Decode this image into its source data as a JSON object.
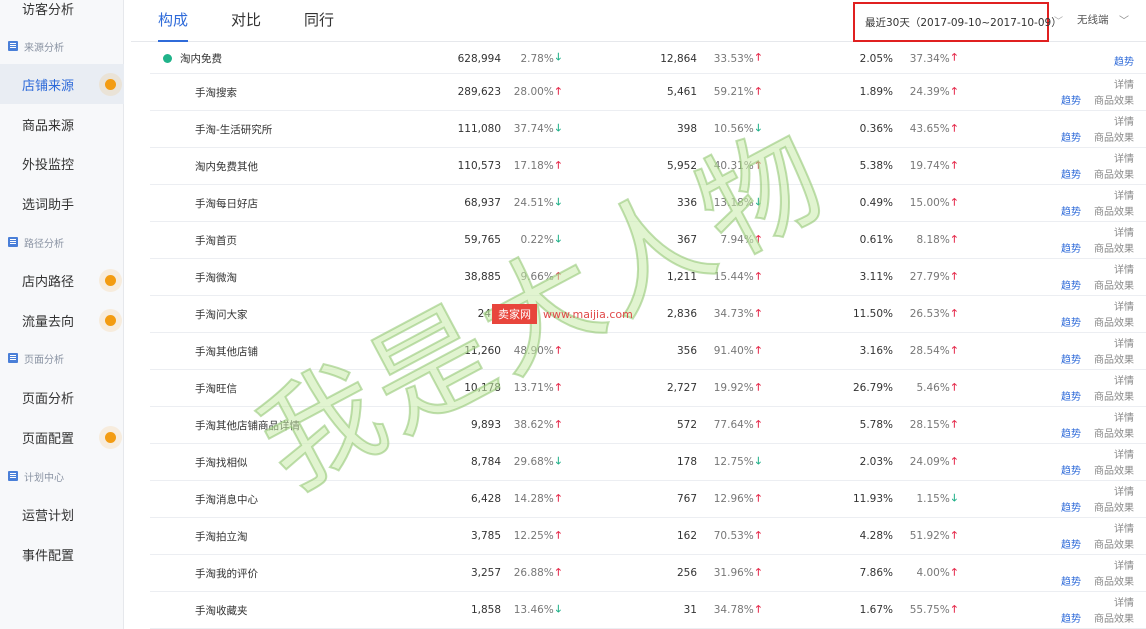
{
  "sidebar": {
    "top_item": "访客分析",
    "sections": [
      {
        "title": "来源分析",
        "items": [
          "店铺来源",
          "商品来源",
          "外投监控",
          "选词助手"
        ]
      },
      {
        "title": "路径分析",
        "items": [
          "店内路径",
          "流量去向"
        ]
      },
      {
        "title": "页面分析",
        "items": [
          "页面分析",
          "页面配置"
        ]
      },
      {
        "title": "计划中心",
        "items": [
          "运营计划",
          "事件配置"
        ]
      }
    ]
  },
  "tabs": [
    "构成",
    "对比",
    "同行"
  ],
  "date_range": "最近30天（2017-09-10~2017-10-09）",
  "device": "无线端",
  "links": {
    "detail": "详情",
    "trend": "趋势",
    "effect": "商品效果"
  },
  "watermark": {
    "text": "我是大人物",
    "site_logo": "卖家网",
    "site_url": "www.maijia.com"
  },
  "colors": {
    "accent": "#2f6bd9",
    "up": "#e5294a",
    "down": "#1fb088",
    "highlight_box": "#e02020"
  },
  "rows": [
    {
      "name": "淘内免费",
      "v1": "628,994",
      "p1": "2.78%",
      "d1": "down",
      "v2": "12,864",
      "p2": "33.53%",
      "d2": "up",
      "v3": "2.05%",
      "p3": "37.34%",
      "d3": "up"
    },
    {
      "name": "手淘搜索",
      "v1": "289,623",
      "p1": "28.00%",
      "d1": "up",
      "v2": "5,461",
      "p2": "59.21%",
      "d2": "up",
      "v3": "1.89%",
      "p3": "24.39%",
      "d3": "up"
    },
    {
      "name": "手淘-生活研究所",
      "v1": "111,080",
      "p1": "37.74%",
      "d1": "down",
      "v2": "398",
      "p2": "10.56%",
      "d2": "down",
      "v3": "0.36%",
      "p3": "43.65%",
      "d3": "up"
    },
    {
      "name": "淘内免费其他",
      "v1": "110,573",
      "p1": "17.18%",
      "d1": "up",
      "v2": "5,952",
      "p2": "40.31%",
      "d2": "up",
      "v3": "5.38%",
      "p3": "19.74%",
      "d3": "up"
    },
    {
      "name": "手淘每日好店",
      "v1": "68,937",
      "p1": "24.51%",
      "d1": "down",
      "v2": "336",
      "p2": "13.18%",
      "d2": "down",
      "v3": "0.49%",
      "p3": "15.00%",
      "d3": "up"
    },
    {
      "name": "手淘首页",
      "v1": "59,765",
      "p1": "0.22%",
      "d1": "down",
      "v2": "367",
      "p2": "7.94%",
      "d2": "up",
      "v3": "0.61%",
      "p3": "8.18%",
      "d3": "up"
    },
    {
      "name": "手淘微淘",
      "v1": "38,885",
      "p1": "9.66%",
      "d1": "up",
      "v2": "1,211",
      "p2": "15.44%",
      "d2": "up",
      "v3": "3.11%",
      "p3": "27.79%",
      "d3": "up"
    },
    {
      "name": "手淘问大家",
      "v1": "24,6",
      "p1": "",
      "d1": "",
      "v2": "2,836",
      "p2": "34.73%",
      "d2": "up",
      "v3": "11.50%",
      "p3": "26.53%",
      "d3": "up"
    },
    {
      "name": "手淘其他店铺",
      "v1": "11,260",
      "p1": "48.90%",
      "d1": "up",
      "v2": "356",
      "p2": "91.40%",
      "d2": "up",
      "v3": "3.16%",
      "p3": "28.54%",
      "d3": "up"
    },
    {
      "name": "手淘旺信",
      "v1": "10,178",
      "p1": "13.71%",
      "d1": "up",
      "v2": "2,727",
      "p2": "19.92%",
      "d2": "up",
      "v3": "26.79%",
      "p3": "5.46%",
      "d3": "up"
    },
    {
      "name": "手淘其他店铺商品详情",
      "v1": "9,893",
      "p1": "38.62%",
      "d1": "up",
      "v2": "572",
      "p2": "77.64%",
      "d2": "up",
      "v3": "5.78%",
      "p3": "28.15%",
      "d3": "up"
    },
    {
      "name": "手淘找相似",
      "v1": "8,784",
      "p1": "29.68%",
      "d1": "down",
      "v2": "178",
      "p2": "12.75%",
      "d2": "down",
      "v3": "2.03%",
      "p3": "24.09%",
      "d3": "up"
    },
    {
      "name": "手淘消息中心",
      "v1": "6,428",
      "p1": "14.28%",
      "d1": "up",
      "v2": "767",
      "p2": "12.96%",
      "d2": "up",
      "v3": "11.93%",
      "p3": "1.15%",
      "d3": "down"
    },
    {
      "name": "手淘拍立淘",
      "v1": "3,785",
      "p1": "12.25%",
      "d1": "up",
      "v2": "162",
      "p2": "70.53%",
      "d2": "up",
      "v3": "4.28%",
      "p3": "51.92%",
      "d3": "up"
    },
    {
      "name": "手淘我的评价",
      "v1": "3,257",
      "p1": "26.88%",
      "d1": "up",
      "v2": "256",
      "p2": "31.96%",
      "d2": "up",
      "v3": "7.86%",
      "p3": "4.00%",
      "d3": "up"
    },
    {
      "name": "手淘收藏夹",
      "v1": "1,858",
      "p1": "13.46%",
      "d1": "down",
      "v2": "31",
      "p2": "34.78%",
      "d2": "up",
      "v3": "1.67%",
      "p3": "55.75%",
      "d3": "up"
    }
  ]
}
